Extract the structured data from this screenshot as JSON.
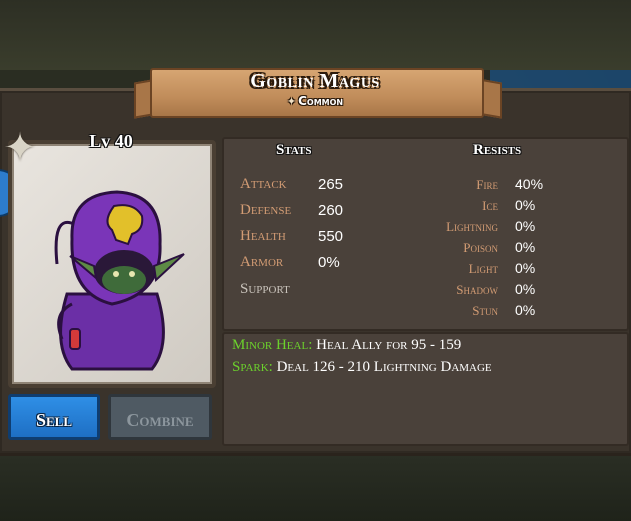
{
  "unit": {
    "name": "Goblin Magus",
    "rarity": "Common",
    "level": "Lv 40"
  },
  "stats": {
    "header": "Stats",
    "rows": [
      {
        "label": "Attack",
        "value": "265"
      },
      {
        "label": "Defense",
        "value": "260"
      },
      {
        "label": "Health",
        "value": "550"
      },
      {
        "label": "Armor",
        "value": "0%"
      },
      {
        "label": "Support",
        "value": ""
      }
    ]
  },
  "resists": {
    "header": "Resists",
    "rows": [
      {
        "label": "Fire",
        "value": "40%"
      },
      {
        "label": "Ice",
        "value": "0%"
      },
      {
        "label": "Lightning",
        "value": "0%"
      },
      {
        "label": "Poison",
        "value": "0%"
      },
      {
        "label": "Light",
        "value": "0%"
      },
      {
        "label": "Shadow",
        "value": "0%"
      },
      {
        "label": "Stun",
        "value": "0%"
      }
    ]
  },
  "abilities": [
    {
      "name": "Minor Heal:",
      "desc": "Heal Ally for 95 - 159"
    },
    {
      "name": "Spark:",
      "desc": "Deal 126 - 210 Lightning Damage"
    }
  ],
  "buttons": {
    "sell": "Sell",
    "combine": "Combine"
  },
  "colors": {
    "ability_name": "#6cd22c",
    "stat_label": "#d39c74",
    "sell_button": "#1e6fc4"
  },
  "icons": {
    "rarity": "star-icon",
    "badge": "star-badge-icon"
  }
}
